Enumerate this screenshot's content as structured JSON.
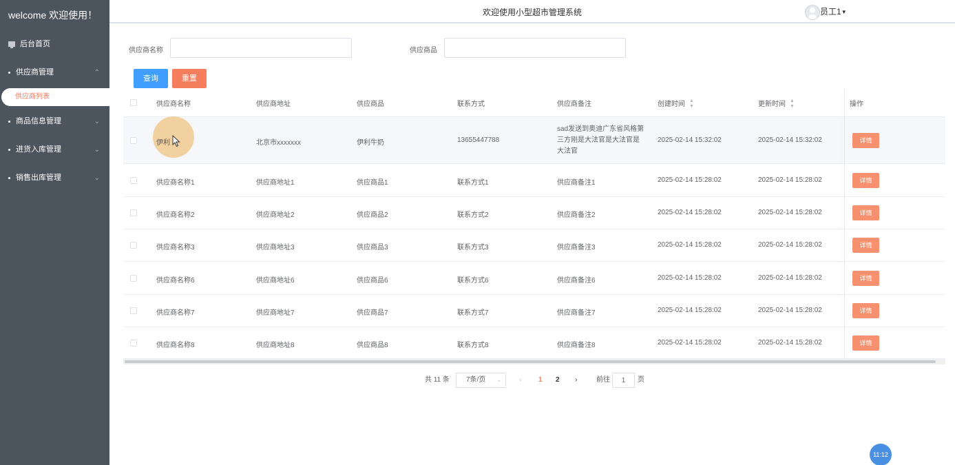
{
  "sidebar": {
    "welcome": "welcome 欢迎使用！",
    "home": "后台首页",
    "supplier_mgmt": "供应商管理",
    "supplier_list": "供应商列表",
    "goods_mgmt": "商品信息管理",
    "stock_in_mgmt": "进货入库管理",
    "sales_out_mgmt": "销售出库管理"
  },
  "header": {
    "title": "欢迎使用小型超市管理系统",
    "user": "员工1"
  },
  "search": {
    "name_label": "供应商名称",
    "name_value": "",
    "goods_label": "供应商品",
    "goods_value": "",
    "query_button": "查询",
    "reset_button": "重置"
  },
  "table": {
    "columns": [
      "供应商名称",
      "供应商地址",
      "供应商品",
      "联系方式",
      "供应商备注",
      "创建时间",
      "更新时间",
      "操作"
    ],
    "detail_label": "详情",
    "rows": [
      {
        "name": "伊利",
        "address": "北京市xxxxxxx",
        "goods": "伊利牛奶",
        "contact": "13655447788",
        "remark": "sad发送到奥迪广东省风格第三方刚是大法官是大法官是大法官",
        "created": "2025-02-14 15:32:02",
        "updated": "2025-02-14 15:32:02"
      },
      {
        "name": "供应商名称1",
        "address": "供应商地址1",
        "goods": "供应商品1",
        "contact": "联系方式1",
        "remark": "供应商备注1",
        "created": "2025-02-14 15:28:02",
        "updated": "2025-02-14 15:28:02"
      },
      {
        "name": "供应商名称2",
        "address": "供应商地址2",
        "goods": "供应商品2",
        "contact": "联系方式2",
        "remark": "供应商备注2",
        "created": "2025-02-14 15:28:02",
        "updated": "2025-02-14 15:28:02"
      },
      {
        "name": "供应商名称3",
        "address": "供应商地址3",
        "goods": "供应商品3",
        "contact": "联系方式3",
        "remark": "供应商备注3",
        "created": "2025-02-14 15:28:02",
        "updated": "2025-02-14 15:28:02"
      },
      {
        "name": "供应商名称6",
        "address": "供应商地址6",
        "goods": "供应商品6",
        "contact": "联系方式6",
        "remark": "供应商备注6",
        "created": "2025-02-14 15:28:02",
        "updated": "2025-02-14 15:28:02"
      },
      {
        "name": "供应商名称7",
        "address": "供应商地址7",
        "goods": "供应商品7",
        "contact": "联系方式7",
        "remark": "供应商备注7",
        "created": "2025-02-14 15:28:02",
        "updated": "2025-02-14 15:28:02"
      },
      {
        "name": "供应商名称8",
        "address": "供应商地址8",
        "goods": "供应商品8",
        "contact": "联系方式8",
        "remark": "供应商备注8",
        "created": "2025-02-14 15:28:02",
        "updated": "2025-02-14 15:28:02"
      }
    ]
  },
  "pagination": {
    "total": "共 11 条",
    "page_size": "7条/页",
    "pages": [
      "1",
      "2"
    ],
    "current_page": "1",
    "goto_label": "前往",
    "goto_value": "1",
    "page_unit": "页"
  },
  "clock": "11:12",
  "colors": {
    "sidebar_bg": "#4c545e",
    "primary": "#409eff",
    "accent": "#f47e5d"
  }
}
